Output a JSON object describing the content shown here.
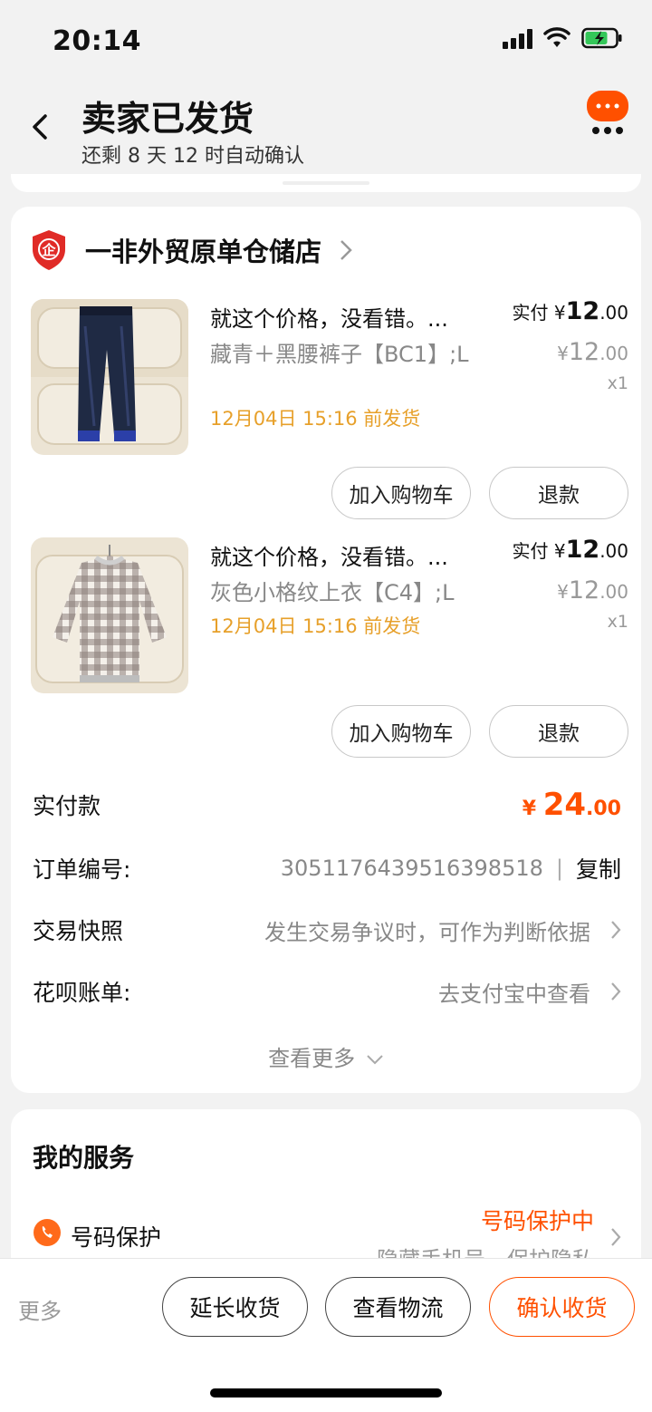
{
  "status_bar": {
    "time": "20:14"
  },
  "header": {
    "title": "卖家已发货",
    "subtitle": "还剩 8 天 12 时自动确认"
  },
  "shop": {
    "name": "一非外贸原单仓储店",
    "badge_text": "企"
  },
  "products": [
    {
      "title": "就这个价格，没看错。...",
      "spec": "藏青＋黑腰裤子【BC1】;L",
      "ship_time": "12月04日 15:16 前发货",
      "paid_label": "实付",
      "paid_symbol": "¥",
      "paid_int": "12",
      "paid_dec": ".00",
      "orig_symbol": "¥",
      "orig_int": "12",
      "orig_dec": ".00",
      "qty": "x1",
      "add_cart_label": "加入购物车",
      "refund_label": "退款"
    },
    {
      "title": "就这个价格，没看错。...",
      "spec": "灰色小格纹上衣【C4】;L",
      "ship_time": "12月04日 15:16 前发货",
      "paid_label": "实付",
      "paid_symbol": "¥",
      "paid_int": "12",
      "paid_dec": ".00",
      "orig_symbol": "¥",
      "orig_int": "12",
      "orig_dec": ".00",
      "qty": "x1",
      "add_cart_label": "加入购物车",
      "refund_label": "退款"
    }
  ],
  "order_info": {
    "total_label": "实付款",
    "total_symbol": "¥",
    "total_int": "24",
    "total_dec": ".00",
    "order_no_label": "订单编号:",
    "order_no": "3051176439516398518",
    "copy_sep": "|",
    "copy_label": "复制",
    "snapshot_label": "交易快照",
    "snapshot_value": "发生交易争议时，可作为判断依据",
    "huabei_label": "花呗账单:",
    "huabei_value": "去支付宝中查看",
    "see_more": "查看更多"
  },
  "services": {
    "title": "我的服务",
    "number_protect_label": "号码保护",
    "number_protect_status": "号码保护中",
    "number_protect_desc": "隐藏手机号，保护隐私"
  },
  "bottom_bar": {
    "more": "更多",
    "extend": "延长收货",
    "logistics": "查看物流",
    "confirm": "确认收货"
  },
  "colors": {
    "accent": "#ff5000",
    "ship_time": "#e7a02a"
  }
}
